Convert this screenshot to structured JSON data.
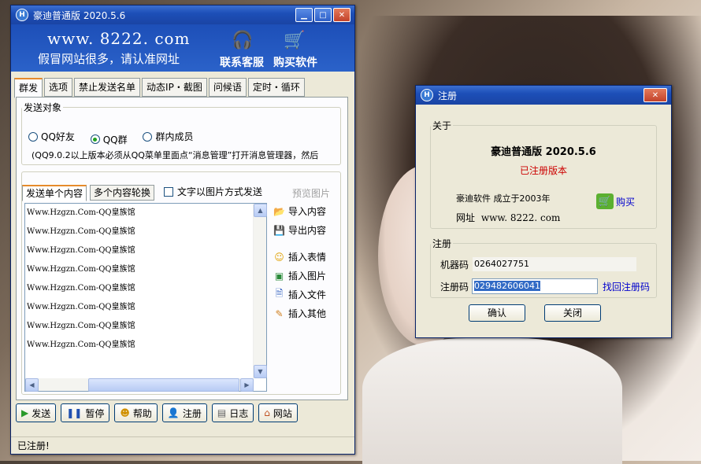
{
  "main_window": {
    "title": "豪迪普通版 2020.5.6",
    "banner": {
      "url": "www. 8222. com",
      "slogan": "假冒网站很多，请认准网址",
      "support_label": "联系客服",
      "buy_label": "购买软件"
    },
    "tabs": [
      "群发",
      "选项",
      "禁止发送名单",
      "动态IP・截图",
      "问候语",
      "定时・循环"
    ],
    "send_target": {
      "legend": "发送对象",
      "options": [
        "QQ好友",
        "QQ群",
        "群内成员"
      ],
      "selected": "QQ群",
      "note": "(QQ9.0.2以上版本必须从QQ菜单里面点“消息管理”打开消息管理器，然后"
    },
    "content": {
      "tab_single": "发送单个内容",
      "tab_multi": "多个内容轮换",
      "image_mode_label": "文字以图片方式发送",
      "preview_label": "预览图片",
      "lines": [
        "Www.Hzgzn.Com-QQ皇族馆",
        "Www.Hzgzn.Com-QQ皇族馆",
        "Www.Hzgzn.Com-QQ皇族馆",
        "Www.Hzgzn.Com-QQ皇族馆",
        "Www.Hzgzn.Com-QQ皇族馆",
        "Www.Hzgzn.Com-QQ皇族馆",
        "Www.Hzgzn.Com-QQ皇族馆",
        "Www.Hzgzn.Com-QQ皇族馆"
      ],
      "actions": [
        "导入内容",
        "导出内容",
        "插入表情",
        "插入图片",
        "插入文件",
        "插入其他"
      ]
    },
    "bottom_buttons": [
      "发送",
      "暂停",
      "帮助",
      "注册",
      "日志",
      "网站"
    ],
    "status": "已注册!"
  },
  "register_dialog": {
    "title": "注册",
    "about_legend": "关于",
    "product": "豪迪普通版  2020.5.6",
    "registered": "已注册版本",
    "company": "豪迪软件   成立于2003年",
    "site_label": "网址",
    "site": "www. 8222. com",
    "buy": "购买",
    "reg_legend": "注册",
    "machine_label": "机器码",
    "machine_code": "0264027751",
    "code_label": "注册码",
    "code_value": "029482606041",
    "recover": "找回注册码",
    "ok": "确认",
    "close": "关闭"
  },
  "colors": {
    "titlebar": "#1d4fb8",
    "registered_red": "#cc0000",
    "link_blue": "#0000cc"
  }
}
